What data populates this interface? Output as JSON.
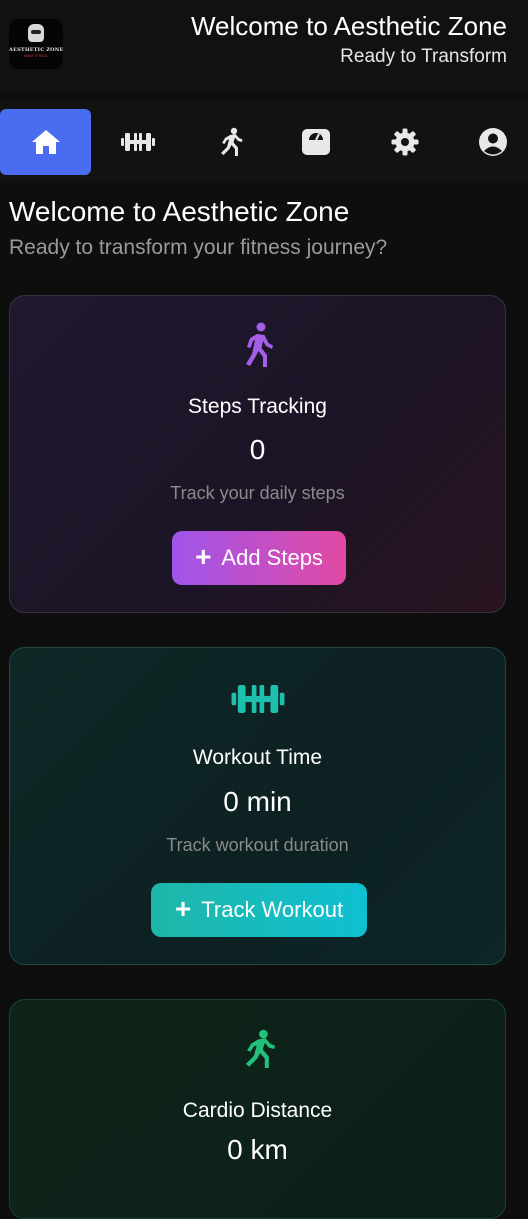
{
  "header": {
    "logo_text": "AESTHETIC ZONE",
    "logo_sub": "MAKE IT REAL",
    "title": "Welcome to Aesthetic Zone",
    "subtitle": "Ready to Transform"
  },
  "tabs": [
    {
      "icon": "home-icon",
      "active": true
    },
    {
      "icon": "dumbbell-icon",
      "active": false
    },
    {
      "icon": "running-icon",
      "active": false
    },
    {
      "icon": "weight-scale-icon",
      "active": false
    },
    {
      "icon": "gear-icon",
      "active": false
    },
    {
      "icon": "user-circle-icon",
      "active": false
    }
  ],
  "main": {
    "heading": "Welcome to Aesthetic Zone",
    "subheading": "Ready to transform your fitness journey?"
  },
  "cards": {
    "steps": {
      "icon": "walking-icon",
      "title": "Steps Tracking",
      "value": "0",
      "description": "Track your daily steps",
      "button_label": "Add Steps",
      "accent": "#a35fe8"
    },
    "workout": {
      "icon": "dumbbell-icon",
      "title": "Workout Time",
      "value": "0 min",
      "description": "Track workout duration",
      "button_label": "Track Workout",
      "accent": "#1fbfae"
    },
    "cardio": {
      "icon": "running-icon",
      "title": "Cardio Distance",
      "value": "0 km",
      "accent": "#22c07a"
    }
  },
  "colors": {
    "background": "#0e0e0e",
    "active_tab": "#4a6cf0"
  }
}
